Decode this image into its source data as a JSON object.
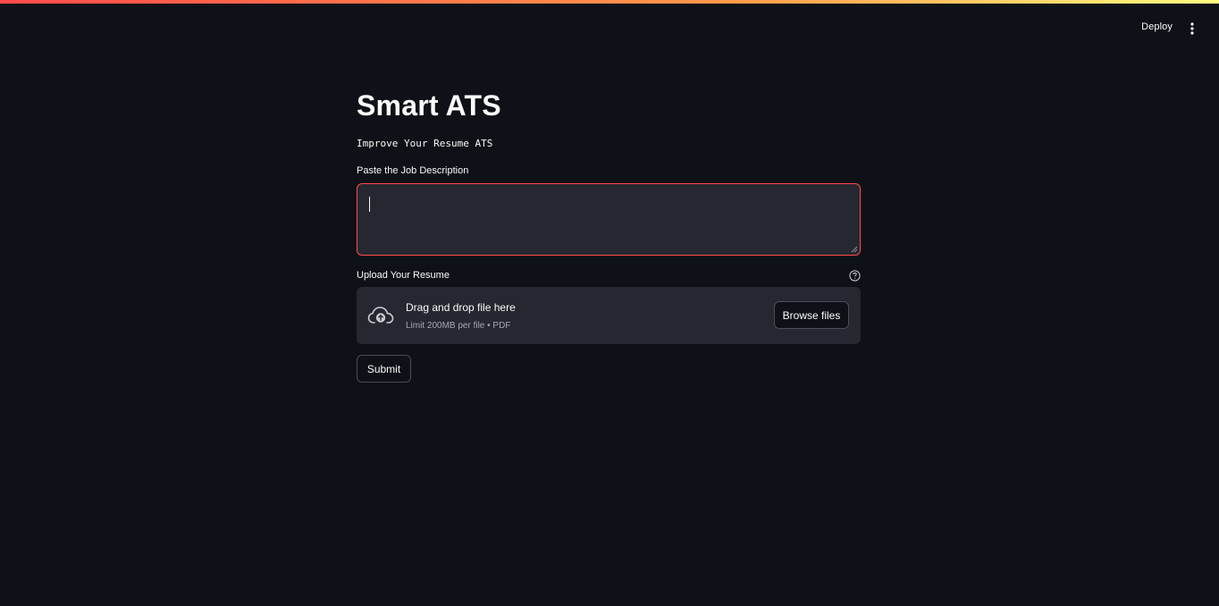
{
  "header": {
    "deploy_label": "Deploy",
    "menu_icon": "vertical-dots-icon"
  },
  "main": {
    "title": "Smart ATS",
    "subtitle": "Improve Your Resume ATS",
    "job_description": {
      "label": "Paste the Job Description",
      "value": "",
      "placeholder": ""
    },
    "upload": {
      "label": "Upload Your Resume",
      "help_icon": "question-circle-icon",
      "dropzone_title": "Drag and drop file here",
      "dropzone_subtitle": "Limit 200MB per file • PDF",
      "upload_icon": "cloud-upload-icon",
      "browse_label": "Browse files"
    },
    "submit_label": "Submit"
  },
  "colors": {
    "background": "#0e1117",
    "input_background": "#262730",
    "focus_border": "#ff4b4b",
    "text": "#fafafa",
    "muted_text": "#a3a8b8"
  }
}
